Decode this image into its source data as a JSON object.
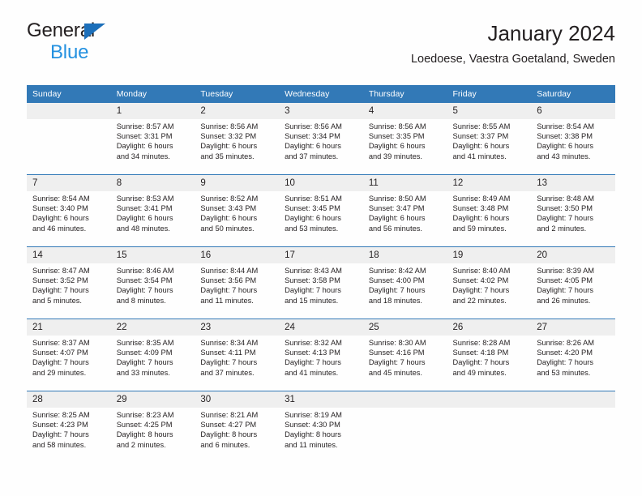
{
  "brand": {
    "line1": "General",
    "line2": "Blue",
    "triangle_color": "#1c6fba",
    "line2_color": "#2491e0"
  },
  "header": {
    "title": "January 2024",
    "subtitle": "Loedoese, Vaestra Goetaland, Sweden"
  },
  "theme": {
    "header_bg": "#3279b7",
    "header_text": "#ffffff",
    "daynum_bg": "#efefef",
    "row_divider": "#3279b7",
    "body_text": "#231f20",
    "page_bg": "#fefefe"
  },
  "calendar": {
    "weekday_headers": [
      "Sunday",
      "Monday",
      "Tuesday",
      "Wednesday",
      "Thursday",
      "Friday",
      "Saturday"
    ],
    "labels": {
      "sunrise": "Sunrise:",
      "sunset": "Sunset:",
      "daylight": "Daylight:"
    },
    "weeks": [
      [
        {
          "day": "",
          "empty": true,
          "l1": "",
          "l2": "",
          "l3": "",
          "l4": ""
        },
        {
          "day": "1",
          "l1": "Sunrise: 8:57 AM",
          "l2": "Sunset: 3:31 PM",
          "l3": "Daylight: 6 hours",
          "l4": "and 34 minutes."
        },
        {
          "day": "2",
          "l1": "Sunrise: 8:56 AM",
          "l2": "Sunset: 3:32 PM",
          "l3": "Daylight: 6 hours",
          "l4": "and 35 minutes."
        },
        {
          "day": "3",
          "l1": "Sunrise: 8:56 AM",
          "l2": "Sunset: 3:34 PM",
          "l3": "Daylight: 6 hours",
          "l4": "and 37 minutes."
        },
        {
          "day": "4",
          "l1": "Sunrise: 8:56 AM",
          "l2": "Sunset: 3:35 PM",
          "l3": "Daylight: 6 hours",
          "l4": "and 39 minutes."
        },
        {
          "day": "5",
          "l1": "Sunrise: 8:55 AM",
          "l2": "Sunset: 3:37 PM",
          "l3": "Daylight: 6 hours",
          "l4": "and 41 minutes."
        },
        {
          "day": "6",
          "l1": "Sunrise: 8:54 AM",
          "l2": "Sunset: 3:38 PM",
          "l3": "Daylight: 6 hours",
          "l4": "and 43 minutes."
        }
      ],
      [
        {
          "day": "7",
          "l1": "Sunrise: 8:54 AM",
          "l2": "Sunset: 3:40 PM",
          "l3": "Daylight: 6 hours",
          "l4": "and 46 minutes."
        },
        {
          "day": "8",
          "l1": "Sunrise: 8:53 AM",
          "l2": "Sunset: 3:41 PM",
          "l3": "Daylight: 6 hours",
          "l4": "and 48 minutes."
        },
        {
          "day": "9",
          "l1": "Sunrise: 8:52 AM",
          "l2": "Sunset: 3:43 PM",
          "l3": "Daylight: 6 hours",
          "l4": "and 50 minutes."
        },
        {
          "day": "10",
          "l1": "Sunrise: 8:51 AM",
          "l2": "Sunset: 3:45 PM",
          "l3": "Daylight: 6 hours",
          "l4": "and 53 minutes."
        },
        {
          "day": "11",
          "l1": "Sunrise: 8:50 AM",
          "l2": "Sunset: 3:47 PM",
          "l3": "Daylight: 6 hours",
          "l4": "and 56 minutes."
        },
        {
          "day": "12",
          "l1": "Sunrise: 8:49 AM",
          "l2": "Sunset: 3:48 PM",
          "l3": "Daylight: 6 hours",
          "l4": "and 59 minutes."
        },
        {
          "day": "13",
          "l1": "Sunrise: 8:48 AM",
          "l2": "Sunset: 3:50 PM",
          "l3": "Daylight: 7 hours",
          "l4": "and 2 minutes."
        }
      ],
      [
        {
          "day": "14",
          "l1": "Sunrise: 8:47 AM",
          "l2": "Sunset: 3:52 PM",
          "l3": "Daylight: 7 hours",
          "l4": "and 5 minutes."
        },
        {
          "day": "15",
          "l1": "Sunrise: 8:46 AM",
          "l2": "Sunset: 3:54 PM",
          "l3": "Daylight: 7 hours",
          "l4": "and 8 minutes."
        },
        {
          "day": "16",
          "l1": "Sunrise: 8:44 AM",
          "l2": "Sunset: 3:56 PM",
          "l3": "Daylight: 7 hours",
          "l4": "and 11 minutes."
        },
        {
          "day": "17",
          "l1": "Sunrise: 8:43 AM",
          "l2": "Sunset: 3:58 PM",
          "l3": "Daylight: 7 hours",
          "l4": "and 15 minutes."
        },
        {
          "day": "18",
          "l1": "Sunrise: 8:42 AM",
          "l2": "Sunset: 4:00 PM",
          "l3": "Daylight: 7 hours",
          "l4": "and 18 minutes."
        },
        {
          "day": "19",
          "l1": "Sunrise: 8:40 AM",
          "l2": "Sunset: 4:02 PM",
          "l3": "Daylight: 7 hours",
          "l4": "and 22 minutes."
        },
        {
          "day": "20",
          "l1": "Sunrise: 8:39 AM",
          "l2": "Sunset: 4:05 PM",
          "l3": "Daylight: 7 hours",
          "l4": "and 26 minutes."
        }
      ],
      [
        {
          "day": "21",
          "l1": "Sunrise: 8:37 AM",
          "l2": "Sunset: 4:07 PM",
          "l3": "Daylight: 7 hours",
          "l4": "and 29 minutes."
        },
        {
          "day": "22",
          "l1": "Sunrise: 8:35 AM",
          "l2": "Sunset: 4:09 PM",
          "l3": "Daylight: 7 hours",
          "l4": "and 33 minutes."
        },
        {
          "day": "23",
          "l1": "Sunrise: 8:34 AM",
          "l2": "Sunset: 4:11 PM",
          "l3": "Daylight: 7 hours",
          "l4": "and 37 minutes."
        },
        {
          "day": "24",
          "l1": "Sunrise: 8:32 AM",
          "l2": "Sunset: 4:13 PM",
          "l3": "Daylight: 7 hours",
          "l4": "and 41 minutes."
        },
        {
          "day": "25",
          "l1": "Sunrise: 8:30 AM",
          "l2": "Sunset: 4:16 PM",
          "l3": "Daylight: 7 hours",
          "l4": "and 45 minutes."
        },
        {
          "day": "26",
          "l1": "Sunrise: 8:28 AM",
          "l2": "Sunset: 4:18 PM",
          "l3": "Daylight: 7 hours",
          "l4": "and 49 minutes."
        },
        {
          "day": "27",
          "l1": "Sunrise: 8:26 AM",
          "l2": "Sunset: 4:20 PM",
          "l3": "Daylight: 7 hours",
          "l4": "and 53 minutes."
        }
      ],
      [
        {
          "day": "28",
          "l1": "Sunrise: 8:25 AM",
          "l2": "Sunset: 4:23 PM",
          "l3": "Daylight: 7 hours",
          "l4": "and 58 minutes."
        },
        {
          "day": "29",
          "l1": "Sunrise: 8:23 AM",
          "l2": "Sunset: 4:25 PM",
          "l3": "Daylight: 8 hours",
          "l4": "and 2 minutes."
        },
        {
          "day": "30",
          "l1": "Sunrise: 8:21 AM",
          "l2": "Sunset: 4:27 PM",
          "l3": "Daylight: 8 hours",
          "l4": "and 6 minutes."
        },
        {
          "day": "31",
          "l1": "Sunrise: 8:19 AM",
          "l2": "Sunset: 4:30 PM",
          "l3": "Daylight: 8 hours",
          "l4": "and 11 minutes."
        },
        {
          "day": "",
          "empty": true,
          "l1": "",
          "l2": "",
          "l3": "",
          "l4": ""
        },
        {
          "day": "",
          "empty": true,
          "l1": "",
          "l2": "",
          "l3": "",
          "l4": ""
        },
        {
          "day": "",
          "empty": true,
          "l1": "",
          "l2": "",
          "l3": "",
          "l4": ""
        }
      ]
    ]
  }
}
